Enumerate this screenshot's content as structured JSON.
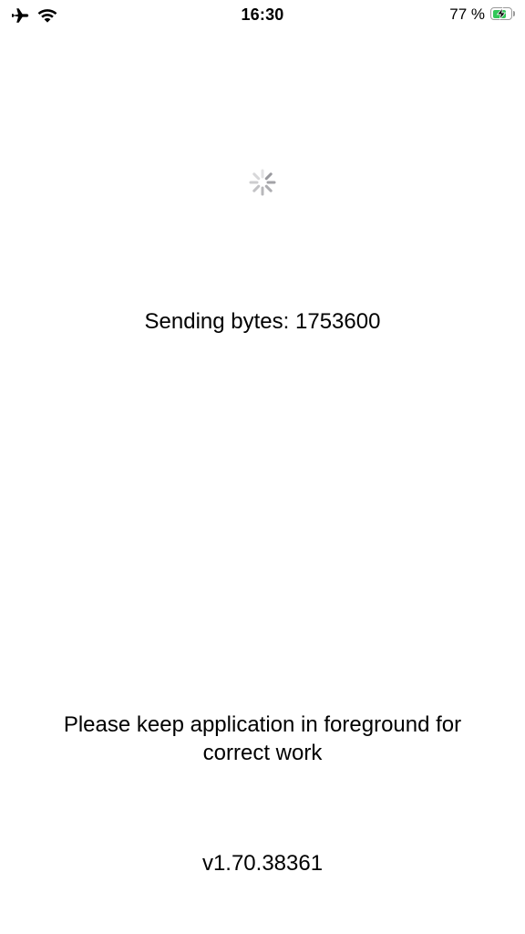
{
  "status_bar": {
    "time": "16:30",
    "battery_percent_text": "77 %",
    "battery_level": 0.77,
    "charging": true,
    "icons": [
      "airplane-icon",
      "wifi-icon",
      "battery-icon",
      "charging-bolt-icon"
    ],
    "battery_color": "#32c759"
  },
  "main": {
    "loading_indicator": "spinner-icon",
    "sending_text": "Sending bytes: 1753600",
    "foreground_notice": "Please keep application in foreground for correct work",
    "version": "v1.70.38361"
  }
}
